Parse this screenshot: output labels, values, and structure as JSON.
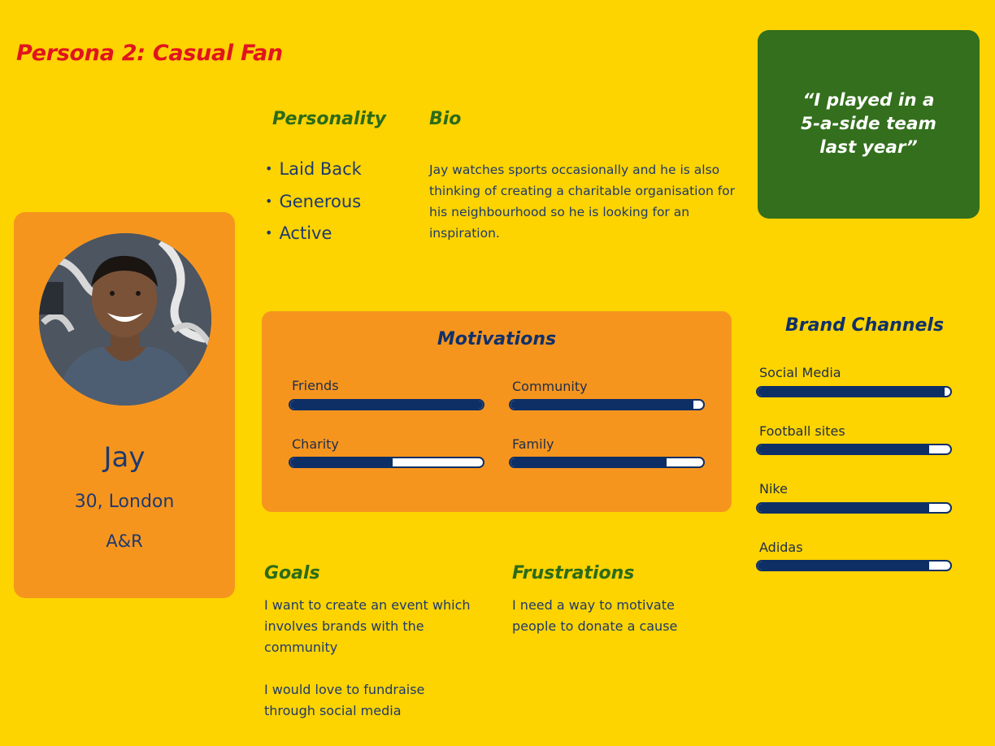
{
  "title": "Persona 2: Casual Fan",
  "profile": {
    "name": "Jay",
    "age_location": "30, London",
    "occupation": "A&R"
  },
  "personality": {
    "heading": "Personality",
    "traits": [
      "Laid Back",
      "Generous",
      "Active"
    ]
  },
  "bio": {
    "heading": "Bio",
    "text": "Jay watches sports occasionally and he is also thinking of creating a charitable organisation for his neighbourhood so he is looking for an inspiration."
  },
  "quote": {
    "line1": "“I played in a",
    "line2": "5-a-side team",
    "line3": "last year”"
  },
  "motivations": {
    "heading": "Motivations",
    "items": [
      {
        "label": "Friends",
        "value": 1.0
      },
      {
        "label": "Community",
        "value": 0.95
      },
      {
        "label": "Charity",
        "value": 0.53
      },
      {
        "label": "Family",
        "value": 0.81
      }
    ]
  },
  "brand_channels": {
    "heading": "Brand Channels",
    "items": [
      {
        "label": "Social Media",
        "value": 0.97
      },
      {
        "label": "Football sites",
        "value": 0.89
      },
      {
        "label": "Nike",
        "value": 0.89
      },
      {
        "label": "Adidas",
        "value": 0.89
      }
    ]
  },
  "goals": {
    "heading": "Goals",
    "paragraph1": "I want to create an event which involves brands with the community",
    "paragraph2": "I would love to fundraise through social media"
  },
  "frustrations": {
    "heading": "Frustrations",
    "text": "I need a way to motivate people to donate a cause"
  },
  "colors": {
    "background": "#FDD300",
    "card_orange": "#F6951E",
    "quote_green": "#336F1C",
    "title_red": "#E0141E",
    "heading_green": "#2C6B19",
    "navy": "#0E2F66"
  }
}
